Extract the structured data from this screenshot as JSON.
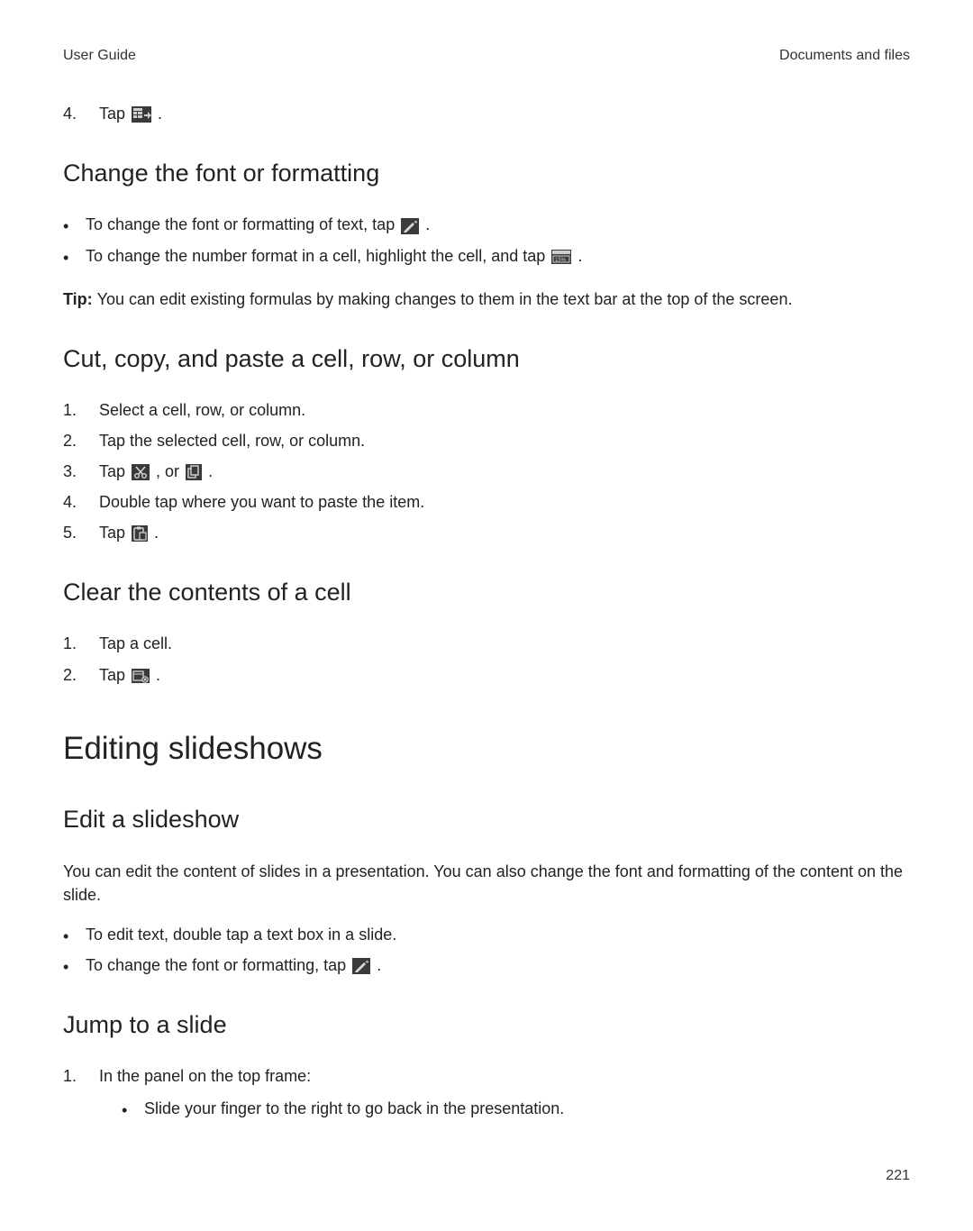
{
  "header": {
    "left": "User Guide",
    "right": "Documents and files"
  },
  "step4_list": {
    "num": "4.",
    "text_before": "Tap ",
    "text_after": " ."
  },
  "sec_font": {
    "heading": "Change the font or formatting",
    "bullets": [
      {
        "before": "To change the font or formatting of text, tap ",
        "after": " ."
      },
      {
        "before": "To change the number format in a cell, highlight the cell, and tap ",
        "after": " ."
      }
    ],
    "tip_label": "Tip: ",
    "tip_text": "You can edit existing formulas by making changes to them in the text bar at the top of the screen."
  },
  "sec_ccp": {
    "heading": "Cut, copy, and paste a cell, row, or column",
    "steps": {
      "s1": {
        "num": "1.",
        "text": "Select a cell, row, or column."
      },
      "s2": {
        "num": "2.",
        "text": "Tap the selected cell, row, or column."
      },
      "s3": {
        "num": "3.",
        "before": "Tap ",
        "mid": " , or ",
        "after": " ."
      },
      "s4": {
        "num": "4.",
        "text": "Double tap where you want to paste the item."
      },
      "s5": {
        "num": "5.",
        "before": "Tap ",
        "after": " ."
      }
    }
  },
  "sec_clear": {
    "heading": "Clear the contents of a cell",
    "steps": {
      "s1": {
        "num": "1.",
        "text": "Tap a cell."
      },
      "s2": {
        "num": "2.",
        "before": "Tap ",
        "after": " ."
      }
    }
  },
  "sec_slideshows": {
    "heading": "Editing slideshows"
  },
  "sec_edit_slide": {
    "heading": "Edit a slideshow",
    "para": "You can edit the content of slides in a presentation. You can also change the font and formatting of the content on the slide.",
    "bullets": {
      "b1": "To edit text, double tap a text box in a slide.",
      "b2_before": "To change the font or formatting, tap ",
      "b2_after": " ."
    }
  },
  "sec_jump": {
    "heading": "Jump to a slide",
    "step1_num": "1.",
    "step1_text": "In the panel on the top frame:",
    "sub_b1": "Slide your finger to the right to go back in the presentation."
  },
  "page_number": "221"
}
